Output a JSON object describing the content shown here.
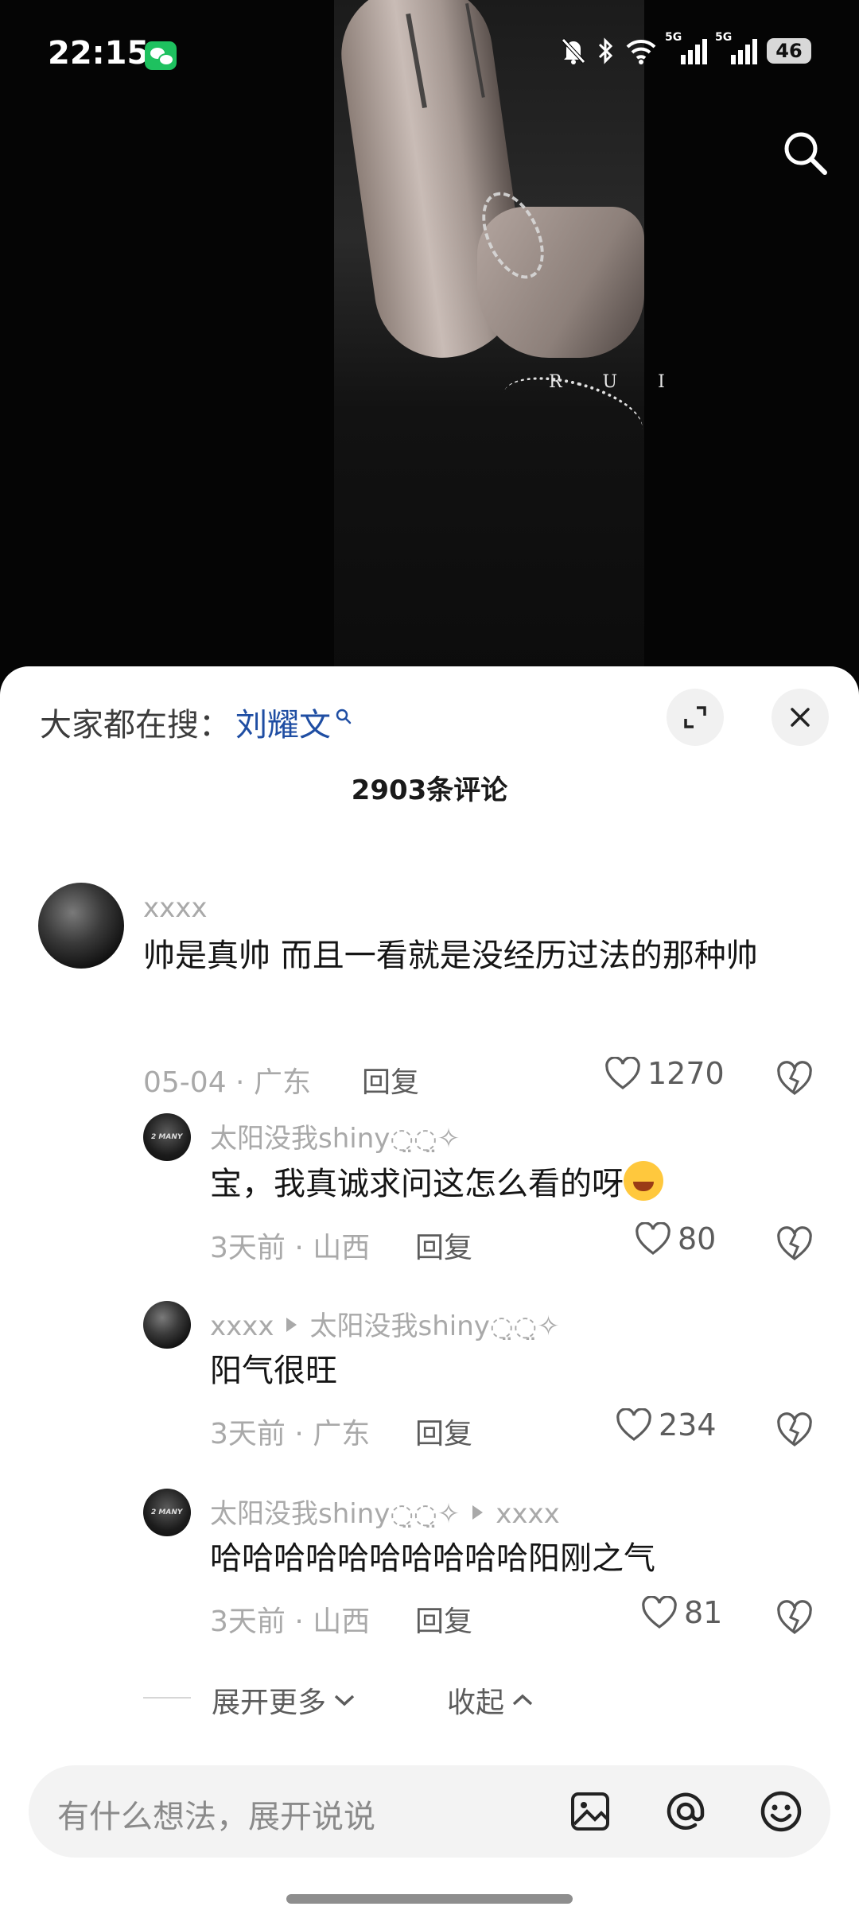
{
  "status_bar": {
    "time": "22:15",
    "icons": [
      "wechat-icon",
      "mute-bell-icon",
      "bluetooth-icon",
      "wifi-icon",
      "signal-5g-icon",
      "signal-5g-icon",
      "battery-icon"
    ],
    "net1": "5G",
    "net2": "5G",
    "battery": "46"
  },
  "video": {
    "overlay_text": "R U I"
  },
  "sheet": {
    "hot_search_label": "大家都在搜：",
    "hot_search_term": "刘耀文",
    "comment_count_title": "2903条评论"
  },
  "comments": [
    {
      "user": "xxxx",
      "text": "帅是真帅 而且一看就是没经历过法的那种帅",
      "meta": "05-04 · 广东",
      "reply_label": "回复",
      "likes": "1270"
    },
    {
      "user": "太阳没我shiny◌̤◌̤✧",
      "text": "宝，我真诚求问这怎么看的呀",
      "meta": "3天前 · 山西",
      "reply_label": "回复",
      "likes": "80",
      "avatar_text": "2 MANY"
    },
    {
      "user": "xxxx",
      "reply_to": "太阳没我shiny◌̤◌̤✧",
      "text": "阳气很旺",
      "meta": "3天前 · 广东",
      "reply_label": "回复",
      "likes": "234"
    },
    {
      "user": "太阳没我shiny◌̤◌̤✧",
      "reply_to": "xxxx",
      "text": "哈哈哈哈哈哈哈哈哈哈阳刚之气",
      "meta": "3天前 · 山西",
      "reply_label": "回复",
      "likes": "81",
      "avatar_text": "2 MANY"
    }
  ],
  "expand": {
    "more_label": "展开更多",
    "collapse_label": "收起"
  },
  "input": {
    "placeholder": "有什么想法，展开说说"
  }
}
